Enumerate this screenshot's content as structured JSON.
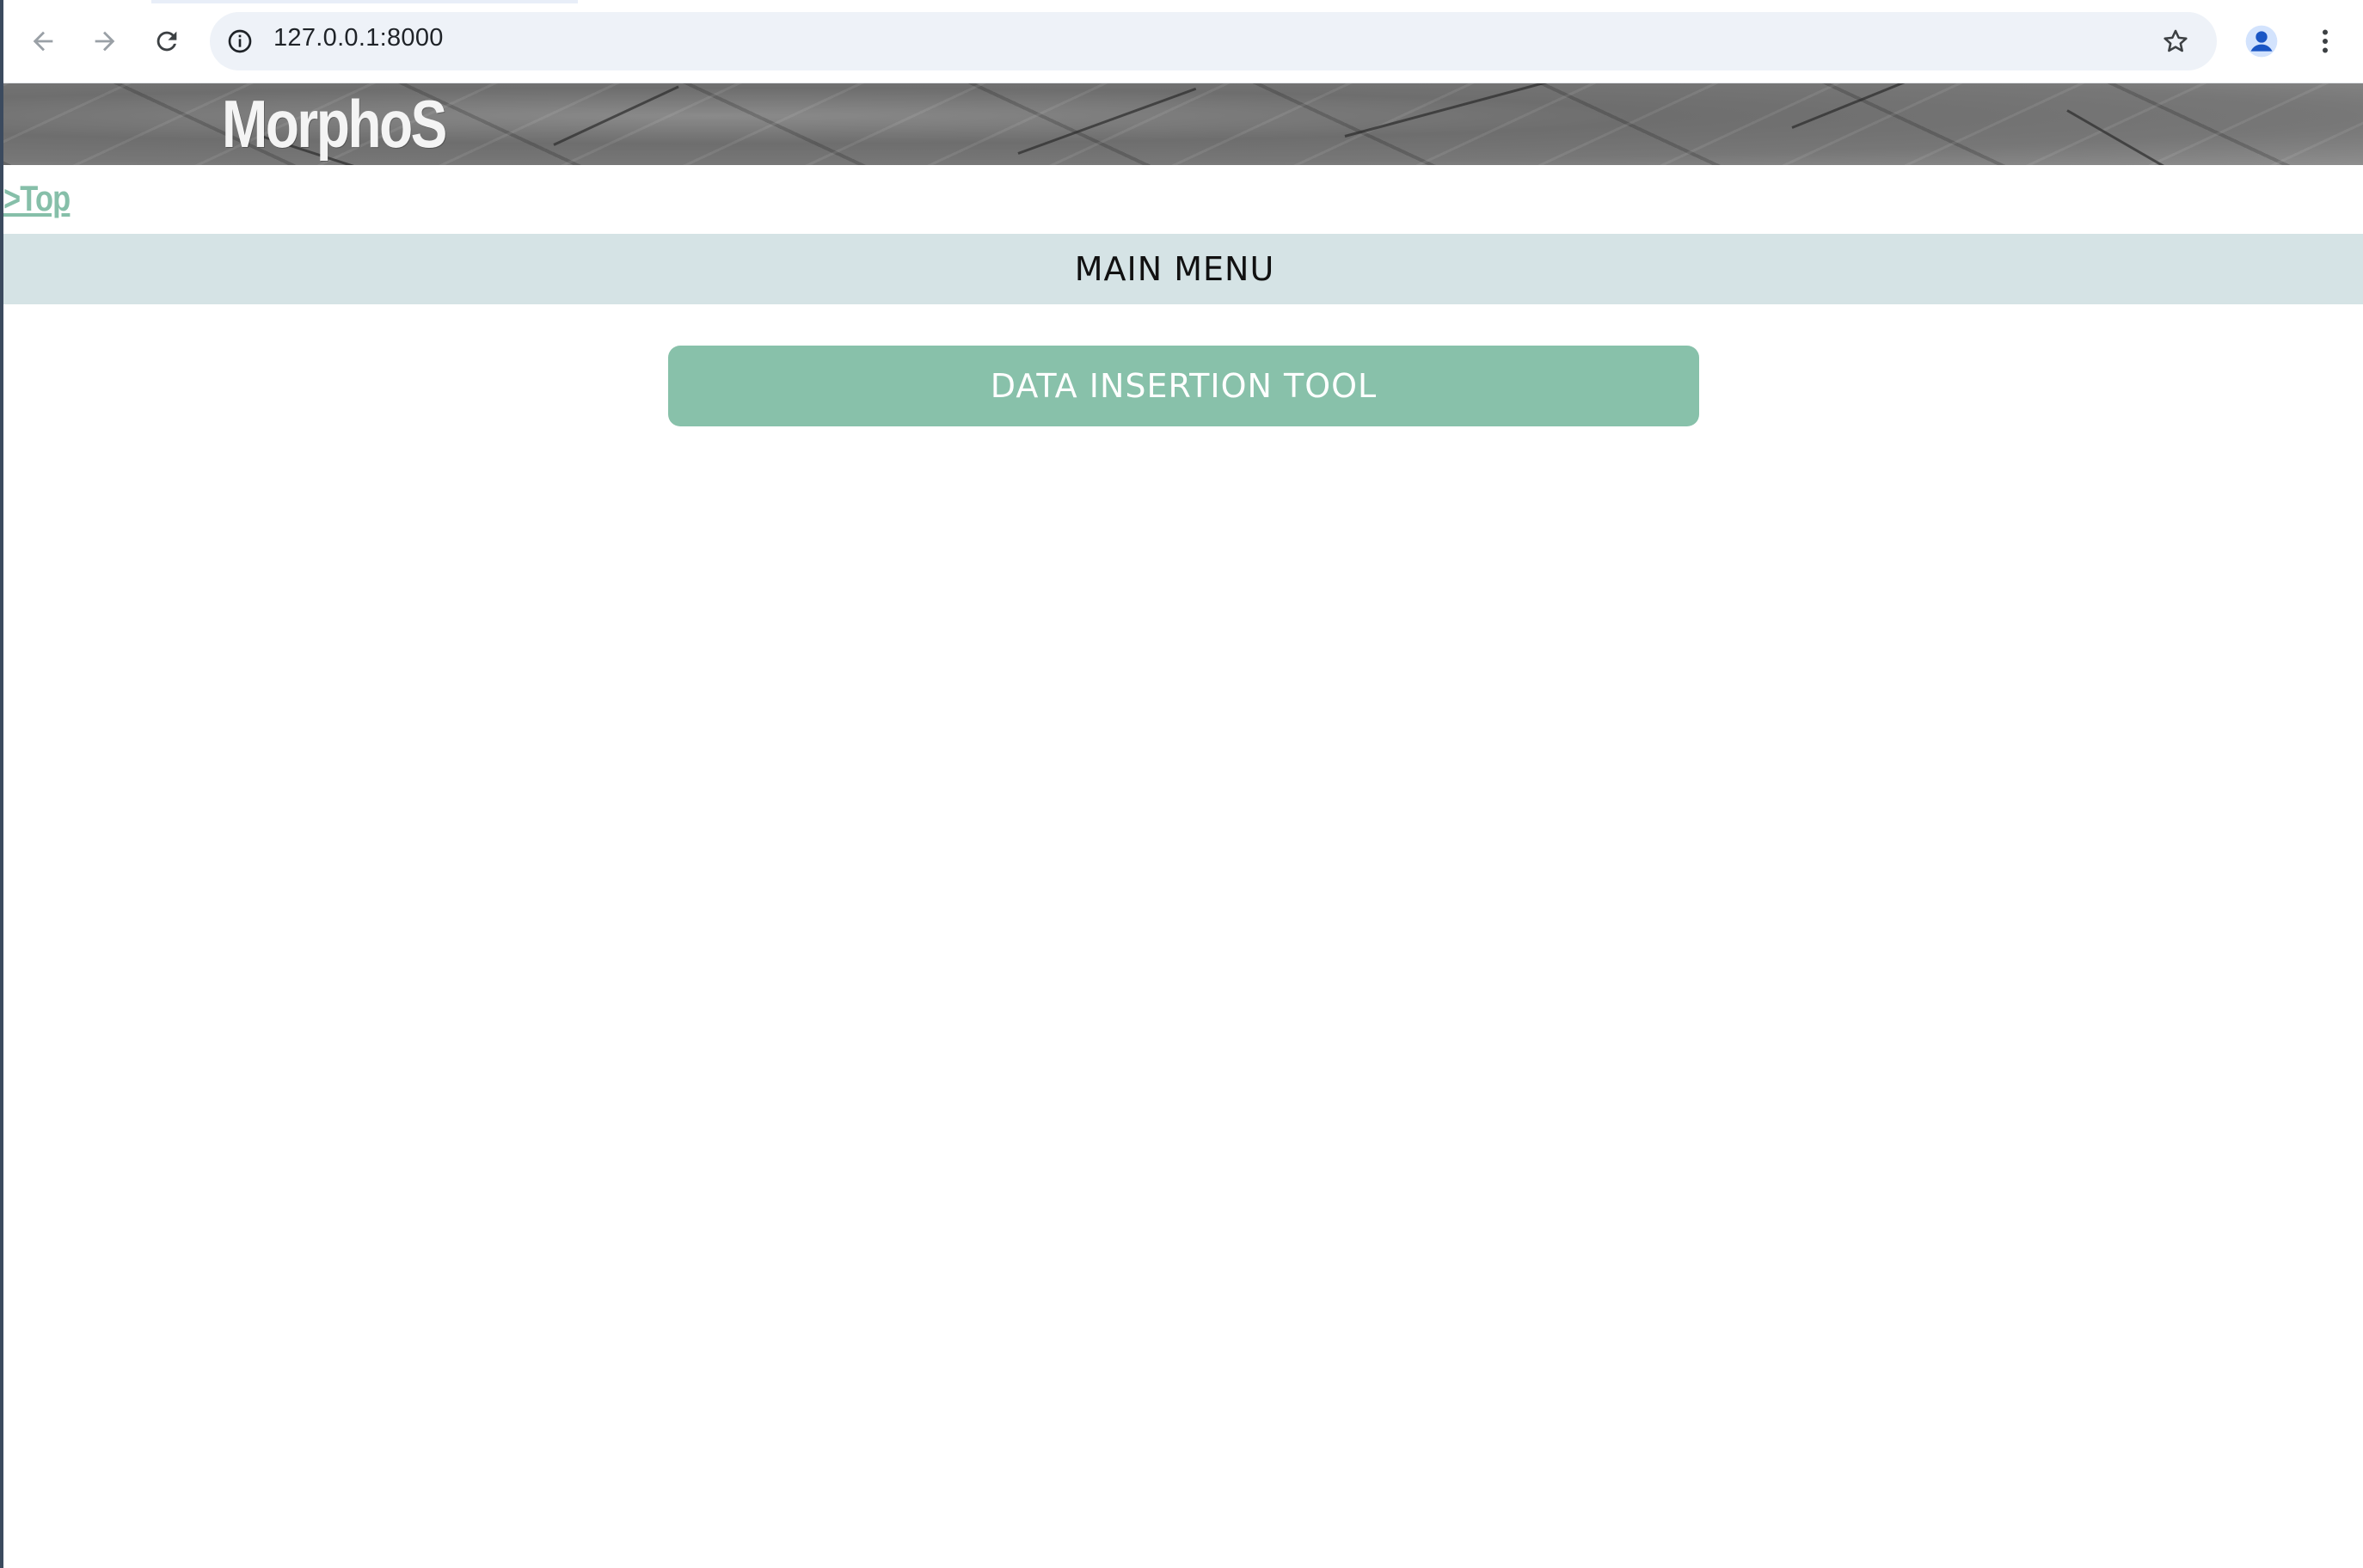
{
  "browser": {
    "url": "127.0.0.1:8000",
    "icons": {
      "back": "arrow-left-icon",
      "forward": "arrow-right-icon",
      "reload": "reload-icon",
      "site_info": "info-icon",
      "bookmark": "star-icon",
      "profile": "profile-icon",
      "menu": "kebab-menu-icon"
    }
  },
  "page": {
    "logo_text": "MorphoS",
    "top_link": ">Top",
    "menu_title": "MAIN MENU",
    "buttons": [
      {
        "label": "DATA INSERTION TOOL"
      }
    ]
  },
  "colors": {
    "accent_green": "#88c1aa",
    "link_green": "#86bfa9",
    "menu_bar": "#d5e3e5"
  }
}
